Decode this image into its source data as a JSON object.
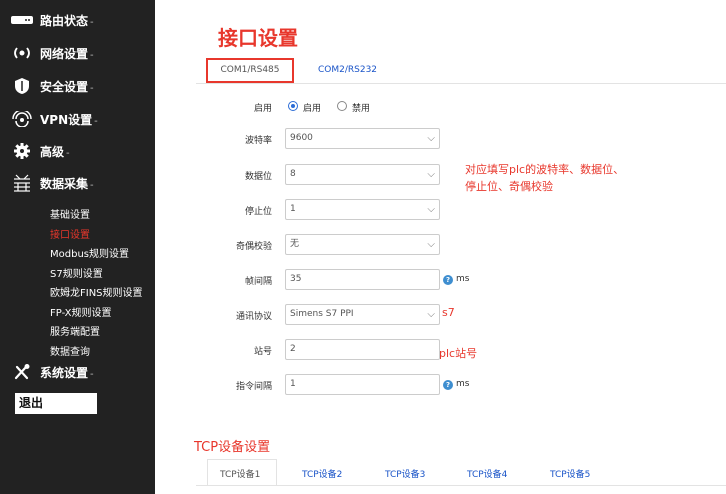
{
  "sidebar": {
    "menu": [
      {
        "label": "路由状态",
        "icon": "router-icon"
      },
      {
        "label": "网络设置",
        "icon": "network-icon"
      },
      {
        "label": "安全设置",
        "icon": "shield-icon"
      },
      {
        "label": "VPN设置",
        "icon": "wifi-icon"
      },
      {
        "label": "高级",
        "icon": "gear-icon"
      },
      {
        "label": "数据采集",
        "icon": "data-collection-icon"
      },
      {
        "label": "系统设置",
        "icon": "wrench-icon"
      }
    ],
    "arrow": "-",
    "submenu": [
      {
        "label": "基础设置"
      },
      {
        "label": "接口设置"
      },
      {
        "label": "Modbus规则设置"
      },
      {
        "label": "S7规则设置"
      },
      {
        "label": "欧姆龙FINS规则设置"
      },
      {
        "label": "FP-X规则设置"
      },
      {
        "label": "服务端配置"
      },
      {
        "label": "数据查询"
      }
    ],
    "active_submenu": "接口设置",
    "logout": "退出"
  },
  "page": {
    "title": "接口设置",
    "tabs": [
      "COM1/RS485",
      "COM2/RS232"
    ]
  },
  "form": {
    "enable_label": "启用",
    "enable_options": [
      "启用",
      "禁用"
    ],
    "enable_value": "启用",
    "baud_label": "波特率",
    "baud_value": "9600",
    "databits_label": "数据位",
    "databits_value": "8",
    "stopbits_label": "停止位",
    "stopbits_value": "1",
    "parity_label": "奇偶校验",
    "parity_value": "无",
    "frame_label": "帧间隔",
    "frame_value": "35",
    "frame_unit": "ms",
    "protocol_label": "通讯协议",
    "protocol_value": "Simens S7 PPI",
    "station_label": "站号",
    "station_value": "2",
    "cmd_label": "指令间隔",
    "cmd_value": "1",
    "cmd_unit": "ms",
    "help_glyph": "?"
  },
  "notes": {
    "serial_line1": "对应填写plc的波特率、数据位、",
    "serial_line2": "停止位、奇偶校验",
    "protocol": "s7",
    "station": "plc站号"
  },
  "tcp": {
    "title": "TCP设备设置",
    "tabs": [
      "TCP设备1",
      "TCP设备2",
      "TCP设备3",
      "TCP设备4",
      "TCP设备5"
    ]
  },
  "colors": {
    "accent_red": "#e8372c",
    "link_blue": "#1a54c8",
    "sidebar_bg": "#222222"
  }
}
